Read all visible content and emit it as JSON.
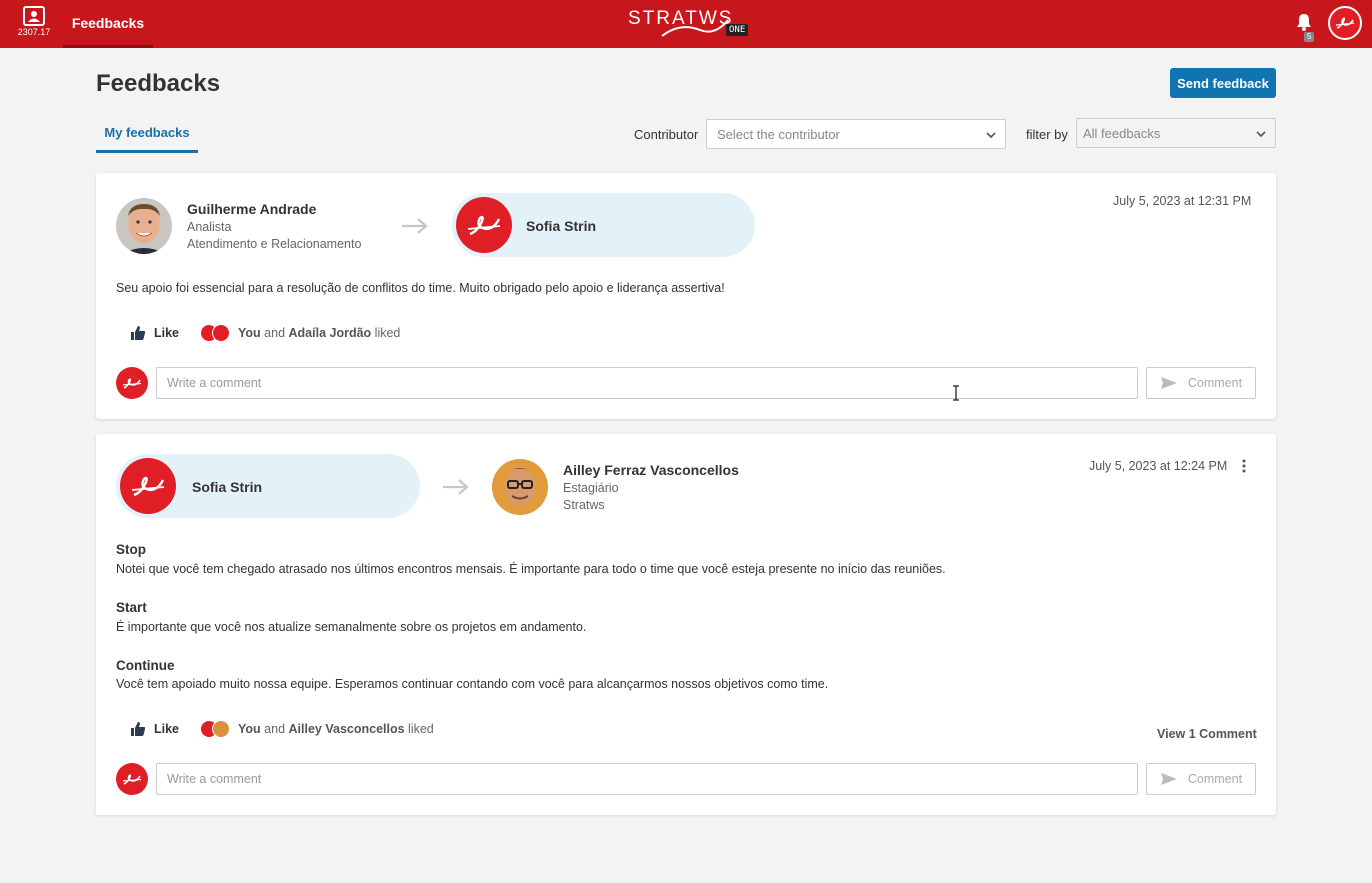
{
  "topbar": {
    "app_number": "2307.17",
    "nav_label": "Feedbacks",
    "brand_word": "STRATWS",
    "brand_badge": "ONE",
    "notification_count": "5"
  },
  "page": {
    "title": "Feedbacks",
    "send_button": "Send feedback",
    "tab_my_feedbacks": "My feedbacks",
    "contributor_label": "Contributor",
    "contributor_placeholder": "Select the contributor",
    "filter_label": "filter by",
    "filter_value": "All feedbacks"
  },
  "feedbacks": [
    {
      "sender": {
        "name": "Guilherme Andrade",
        "role": "Analista",
        "team": "Atendimento e Relacionamento"
      },
      "receiver": {
        "name": "Sofia Strin"
      },
      "date": "July 5, 2023 at 12:31 PM",
      "message": "Seu apoio foi essencial para a resolução de conflitos do time. Muito obrigado pelo apoio e liderança assertiva!",
      "like_label": "Like",
      "likers_you": "You",
      "likers_and": "and",
      "likers_other": "Adaíla Jordão",
      "likers_suffix": "liked",
      "comment_placeholder": "Write a comment",
      "comment_button": "Comment"
    },
    {
      "sender": {
        "name": "Sofia Strin"
      },
      "receiver": {
        "name": "Ailley Ferraz Vasconcellos",
        "role": "Estagiário",
        "team": "Stratws"
      },
      "date": "July 5, 2023 at 12:24 PM",
      "sections": [
        {
          "title": "Stop",
          "text": "Notei que você tem chegado atrasado nos últimos encontros mensais. É importante para todo o time que você esteja presente no início das reuniões."
        },
        {
          "title": "Start",
          "text": "É importante que você nos atualize semanalmente sobre os projetos em andamento."
        },
        {
          "title": "Continue",
          "text": "Você tem apoiado muito nossa equipe. Esperamos continuar contando com você para alcançarmos nossos objetivos como time."
        }
      ],
      "like_label": "Like",
      "likers_you": "You",
      "likers_and": "and",
      "likers_other": "Ailley Vasconcellos",
      "likers_suffix": "liked",
      "view_comments": "View 1 Comment",
      "comment_placeholder": "Write a comment",
      "comment_button": "Comment"
    }
  ],
  "colors": {
    "brand_red": "#c8161d",
    "primary_blue": "#1074b0",
    "pill_bg": "#e3f1f9"
  }
}
